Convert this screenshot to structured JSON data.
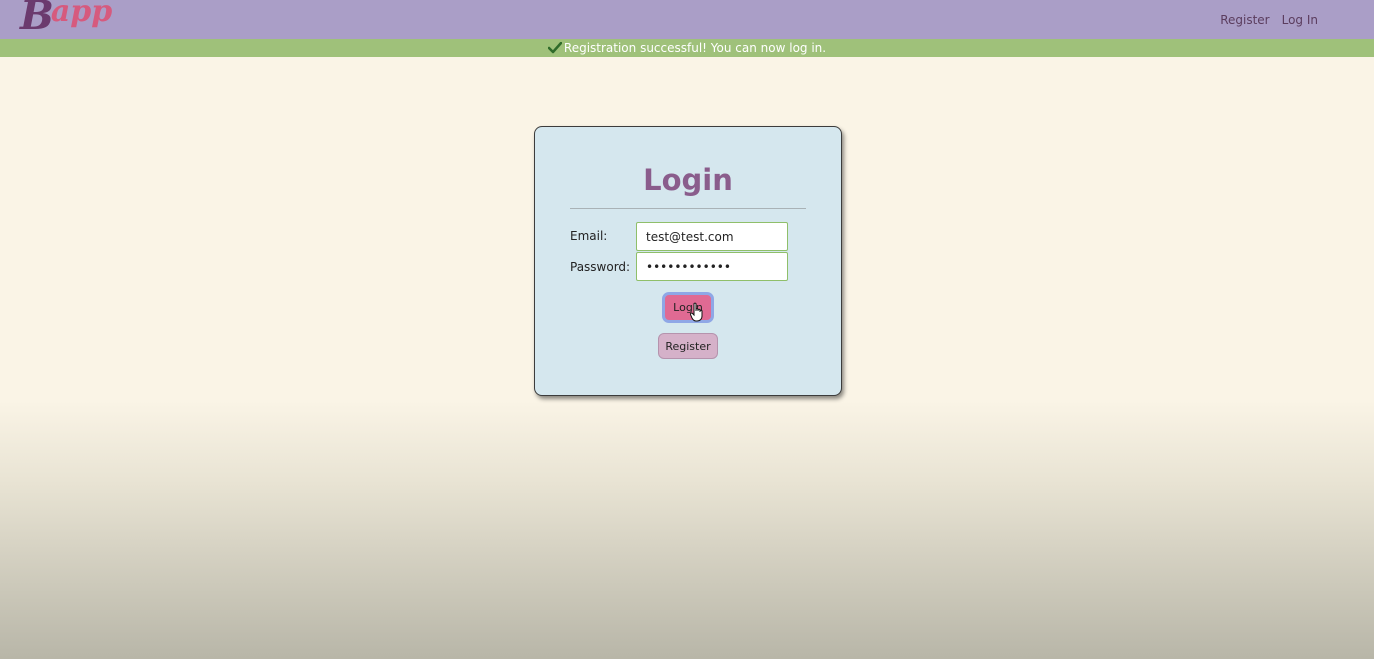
{
  "brand": {
    "logo_big": "B",
    "logo_small": "app"
  },
  "nav": {
    "register_label": "Register",
    "login_label": "Log In"
  },
  "flash": {
    "icon": "checkmark-icon",
    "message": "Registration successful! You can now log in.",
    "color": "#9fc17a"
  },
  "login_form": {
    "title": "Login",
    "email_label": "Email:",
    "email_value": "test@test.com",
    "password_label": "Password:",
    "password_value": "••••••••••••",
    "login_button_label": "Login",
    "register_button_label": "Register"
  },
  "colors": {
    "navbar": "#aa9ec7",
    "card": "#d5e7ee",
    "title": "#8a5d8c",
    "login_button": "#e06a93",
    "register_button": "#d5b1c9"
  }
}
